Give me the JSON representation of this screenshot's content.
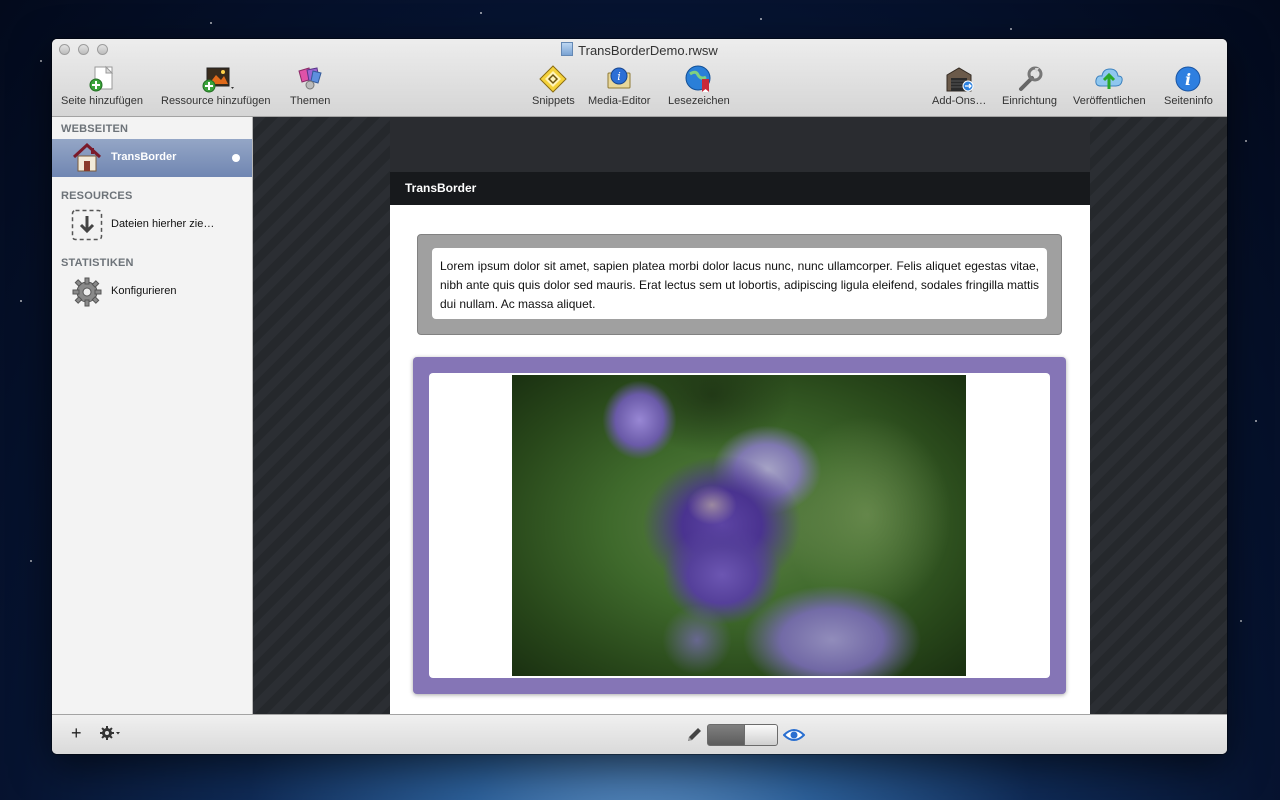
{
  "window": {
    "title": "TransBorderDemo.rwsw"
  },
  "toolbar": {
    "left": [
      {
        "label": "Seite hinzufügen",
        "icon": "add-page-icon"
      },
      {
        "label": "Ressource hinzufügen",
        "icon": "add-resource-icon"
      },
      {
        "label": "Themen",
        "icon": "themes-icon"
      }
    ],
    "center": [
      {
        "label": "Snippets",
        "icon": "snippets-icon"
      },
      {
        "label": "Media-Editor",
        "icon": "media-editor-icon"
      },
      {
        "label": "Lesezeichen",
        "icon": "bookmarks-icon"
      }
    ],
    "right": [
      {
        "label": "Add-Ons…",
        "icon": "addons-icon"
      },
      {
        "label": "Einrichtung",
        "icon": "setup-wrench-icon"
      },
      {
        "label": "Veröffentlichen",
        "icon": "publish-cloud-icon"
      },
      {
        "label": "Seiteninfo",
        "icon": "info-icon"
      }
    ]
  },
  "sidebar": {
    "sections": [
      {
        "heading": "WEBSEITEN",
        "items": [
          {
            "label": "TransBorder",
            "icon": "home-page-icon",
            "selected": true
          }
        ]
      },
      {
        "heading": "RESOURCES",
        "items": [
          {
            "label": "Dateien hierher zie…",
            "icon": "drop-files-icon"
          }
        ]
      },
      {
        "heading": "STATISTIKEN",
        "items": [
          {
            "label": "Konfigurieren",
            "icon": "gear-icon"
          }
        ]
      }
    ]
  },
  "page": {
    "title": "TransBorder",
    "text": "Lorem ipsum dolor sit amet, sapien platea morbi dolor lacus nunc, nunc ullamcorper. Felis aliquet egestas vitae, nibh ante quis quis dolor sed mauris. Erat lectus sem ut lobortis, adipiscing ligula eleifend, sodales fringilla mattis dui nullam. Ac massa aliquet.",
    "image": "lavender-photo"
  },
  "bottombar": {
    "add_label": "+",
    "mode_toggle": "preview",
    "icons": [
      "add-icon",
      "gear-menu-icon",
      "pencil-icon",
      "eye-icon"
    ]
  },
  "colors": {
    "frame": "#8575b6",
    "selection": "#7f93bc",
    "page_bar": "#17191c"
  }
}
